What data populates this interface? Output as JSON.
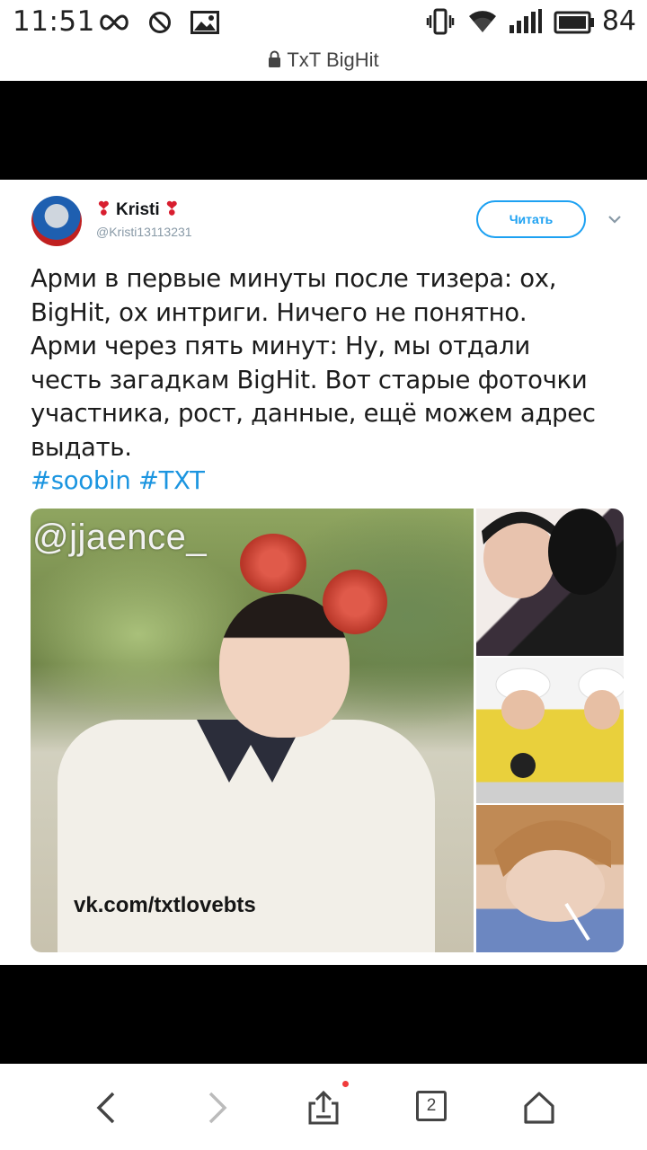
{
  "status_bar": {
    "time": "11:51",
    "battery_level": "84",
    "icons": [
      "infinity-icon",
      "do-not-disturb-icon",
      "image-icon",
      "vibrate-icon",
      "wifi-icon",
      "signal-icon",
      "battery-icon"
    ]
  },
  "browser": {
    "title": "TxT BigHit",
    "secure": true,
    "tab_count": "2"
  },
  "tweet": {
    "author_name": "Kristi",
    "author_handle": "@Kristi13113231",
    "follow_label": "Читать",
    "text_lines": [
      "Арми в первые минуты после тизера: ох,",
      "BigHit, ох интриги. Ничего не понятно.",
      "Арми через пять минут: Ну, мы отдали",
      "честь загадкам BigHit. Вот старые фоточки",
      "участника, рост, данные, ещё можем адрес",
      "выдать."
    ],
    "hashtags": "#soobin #TXT",
    "image": {
      "watermark_top": "@jjaence_",
      "watermark_bottom": "vk.com/txtlovebts"
    }
  },
  "colors": {
    "accent": "#1da1f2",
    "hashtag": "#1b95e0",
    "heart": "#d81e2f"
  }
}
